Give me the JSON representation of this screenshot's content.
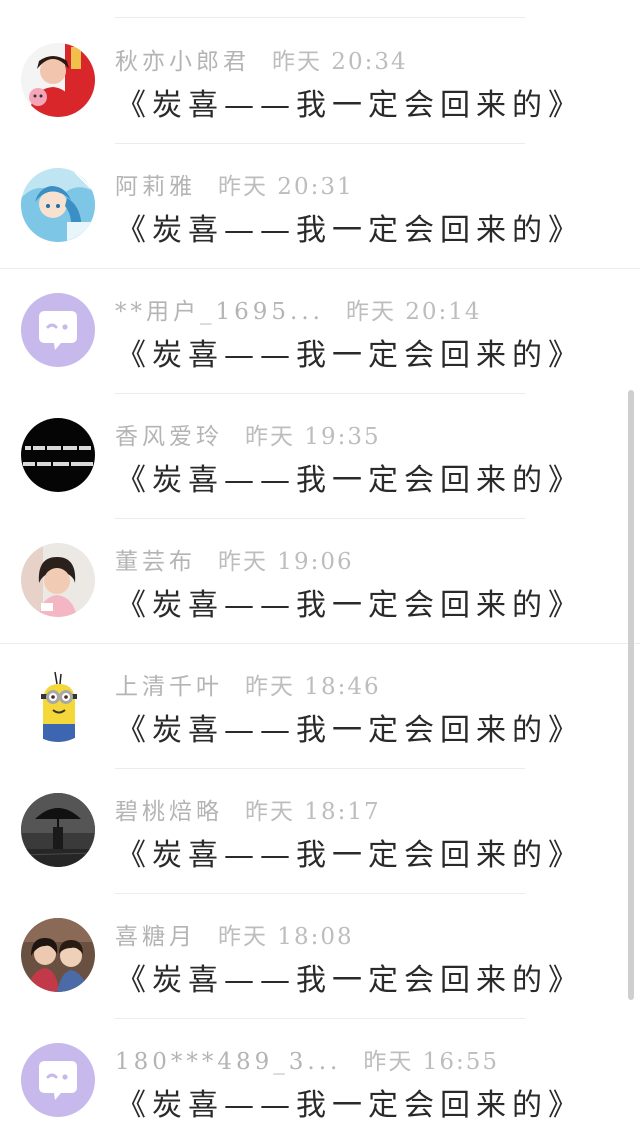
{
  "comments": [
    {
      "user": "秋亦小郎君",
      "time": "昨天 20:34",
      "message": "《炭喜——我一定会回来的》",
      "avatar": "avatar-person-red"
    },
    {
      "user": "阿莉雅",
      "time": "昨天 20:31",
      "message": "《炭喜——我一定会回来的》",
      "avatar": "avatar-anime"
    },
    {
      "user": "**用户_1695...",
      "time": "昨天 20:14",
      "message": "《炭喜——我一定会回来的》",
      "avatar": "default-chat-icon"
    },
    {
      "user": "香风爱玲",
      "time": "昨天 19:35",
      "message": "《炭喜——我一定会回来的》",
      "avatar": "avatar-black-text"
    },
    {
      "user": "董芸布",
      "time": "昨天 19:06",
      "message": "《炭喜——我一定会回来的》",
      "avatar": "avatar-child"
    },
    {
      "user": "上清千叶",
      "time": "昨天 18:46",
      "message": "《炭喜——我一定会回来的》",
      "avatar": "avatar-minion"
    },
    {
      "user": "碧桃焙略",
      "time": "昨天 18:17",
      "message": "《炭喜——我一定会回来的》",
      "avatar": "avatar-umbrella"
    },
    {
      "user": "喜糖月",
      "time": "昨天 18:08",
      "message": "《炭喜——我一定会回来的》",
      "avatar": "avatar-couple"
    },
    {
      "user": "180***489_3...",
      "time": "昨天 16:55",
      "message": "《炭喜——我一定会回来的》",
      "avatar": "default-chat-icon"
    }
  ]
}
